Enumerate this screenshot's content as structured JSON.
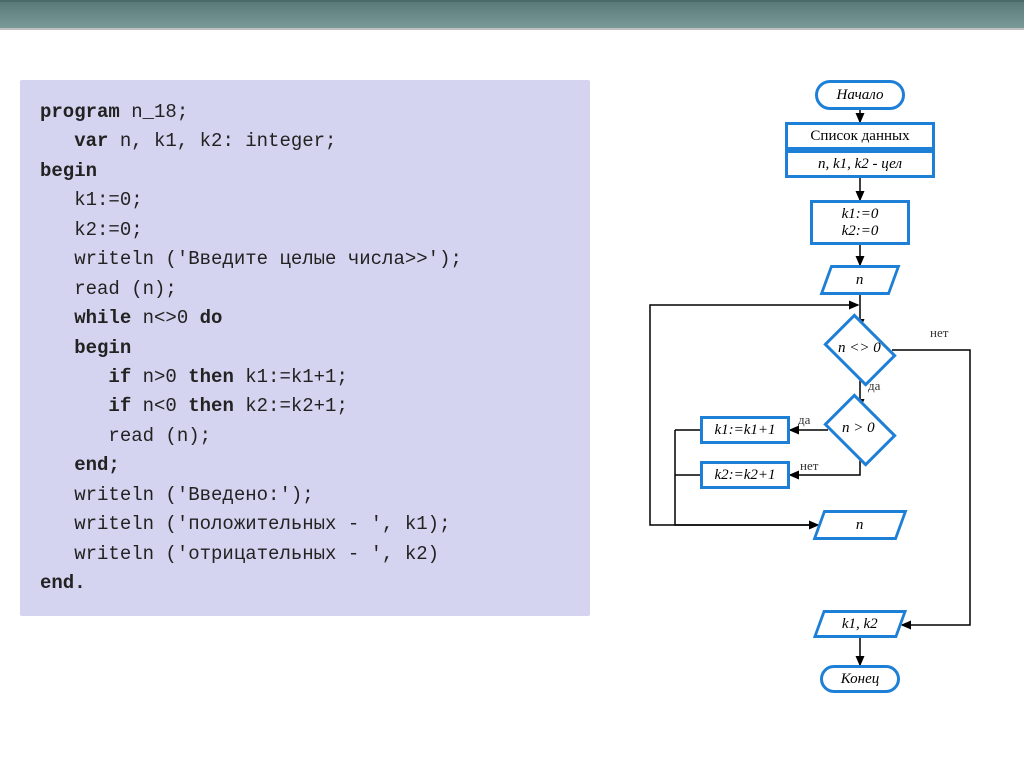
{
  "code": {
    "l1a": "program",
    "l1b": " n_18;",
    "l2a": "   var",
    "l2b": " n, k1, k2: integer;",
    "l3": "begin",
    "l4": "   k1:=0;",
    "l5": "   k2:=0;",
    "l6": "   writeln ('Введите целые числа>>');",
    "l7": "   read (n);",
    "l8a": "   while",
    "l8b": " n<>0 ",
    "l8c": "do",
    "l9": "   begin",
    "l10a": "      if",
    "l10b": " n>0 ",
    "l10c": "then",
    "l10d": " k1:=k1+1;",
    "l11a": "      if",
    "l11b": " n<0 ",
    "l11c": "then",
    "l11d": " k2:=k2+1;",
    "l12": "      read (n);",
    "l13": "   end;",
    "l14": "   writeln ('Введено:');",
    "l15": "   writeln ('положительных - ', k1);",
    "l16": "   writeln ('отрицательных - ', k2)",
    "l17": "end."
  },
  "flow": {
    "start": "Начало",
    "list": "Список данных",
    "vars": "n, k1, k2 - цел",
    "init": "k1:=0\nk2:=0",
    "read_n": "n",
    "cond1": "n <> 0",
    "cond2": "n > 0",
    "k1inc": "k1:=k1+1",
    "k2inc": "k2:=k2+1",
    "read_n2": "n",
    "out": "k1, k2",
    "end": "Конец",
    "yes": "да",
    "no": "нет"
  }
}
